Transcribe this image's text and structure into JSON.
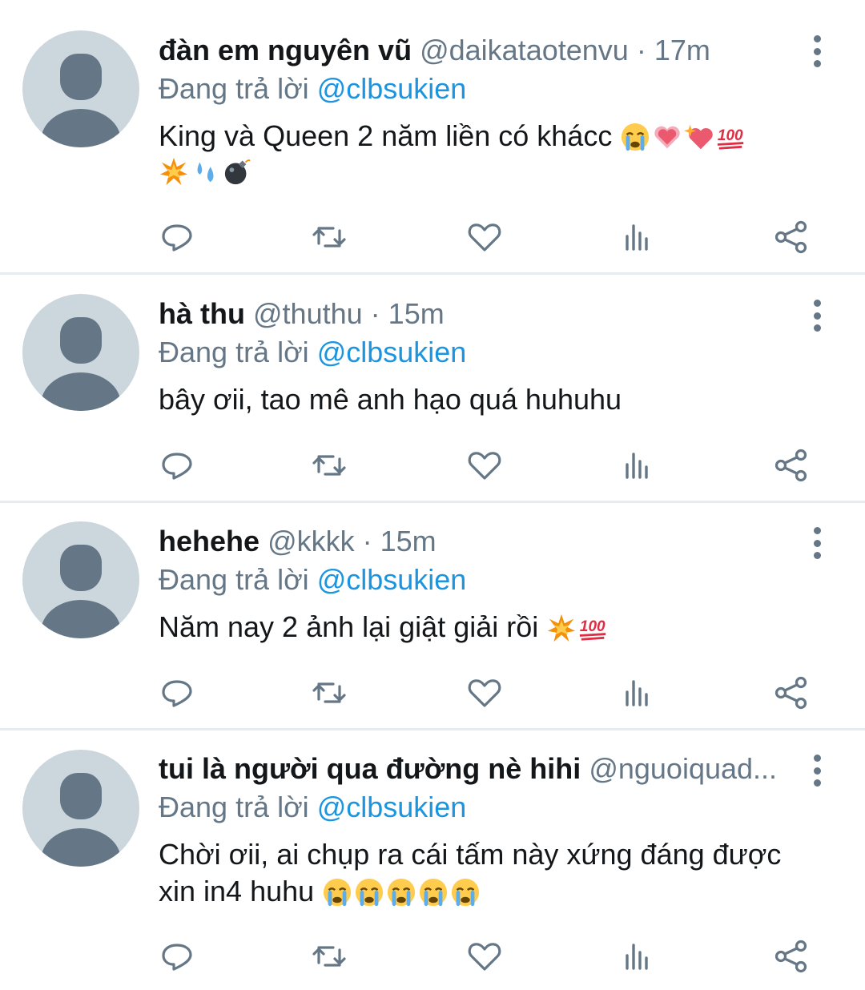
{
  "reply_prefix": "Đang trả lời",
  "tweets": [
    {
      "name": "đàn em nguyên vũ",
      "handle": "@daikataotenvu",
      "separator": "·",
      "time": "17m",
      "reply_to": "@clbsukien",
      "text": "King và Queen 2 năm liền có khácc",
      "emojis_inline": [
        "crying-face",
        "pink-heart",
        "sparkling-heart",
        "hundred-points"
      ],
      "emojis_next_line": [
        "collision",
        "sweat-droplets",
        "bomb"
      ]
    },
    {
      "name": "hà thu",
      "handle": "@thuthu",
      "separator": "·",
      "time": "15m",
      "reply_to": "@clbsukien",
      "text": "bây ơii, tao mê anh hạo quá huhuhu",
      "emojis_inline": [],
      "emojis_next_line": []
    },
    {
      "name": "hehehe",
      "handle": "@kkkk",
      "separator": "·",
      "time": "15m",
      "reply_to": "@clbsukien",
      "text": "Năm nay 2 ảnh lại giật giải rồi",
      "emojis_inline": [
        "collision",
        "hundred-points"
      ],
      "emojis_next_line": []
    },
    {
      "name": "tui là người qua đường nè hihi",
      "handle": "@nguoiquad...",
      "separator": "",
      "time": "",
      "reply_to": "@clbsukien",
      "text": "Chời ơii, ai chụp ra cái tấm này xứng đáng được",
      "text_line2": "xin in4 huhu",
      "emojis_inline": [],
      "emojis_line2": [
        "crying-face",
        "crying-face",
        "crying-face",
        "crying-face",
        "crying-face"
      ],
      "emojis_next_line": []
    }
  ],
  "action_icons": [
    "reply-icon",
    "retweet-icon",
    "like-icon",
    "analytics-icon",
    "share-icon"
  ],
  "colors": {
    "text_primary": "#14171a",
    "text_secondary": "#657786",
    "mention": "#1b95e0",
    "divider": "#e6ecf0",
    "avatar_bg": "#ccd6dd"
  }
}
